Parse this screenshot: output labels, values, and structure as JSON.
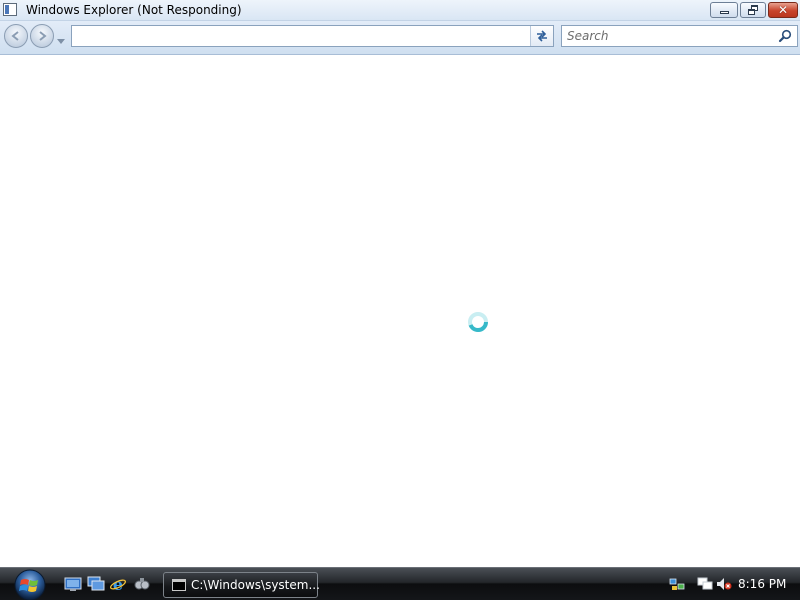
{
  "window": {
    "title": "Windows Explorer (Not Responding)",
    "caption_buttons": {
      "minimize": "minimize",
      "restore": "restore",
      "close": "✕"
    }
  },
  "nav": {
    "address_value": "",
    "search_placeholder": "Search"
  },
  "content": {
    "state": "busy",
    "cursor": "busy-cursor-icon"
  },
  "taskbar": {
    "start_icon": "windows-logo-icon",
    "quick_launch": [
      "show-desktop-icon",
      "switch-windows-icon",
      "ie-icon",
      "media-player-icon"
    ],
    "task_button": {
      "label": "C:\\Windows\\system...",
      "icon": "cmd-icon"
    },
    "tray_icons": [
      "network-tray-icon",
      "connection-icon",
      "volume-muted-icon"
    ],
    "clock": "8:16 PM"
  },
  "colors": {
    "titlebar": "#dce8f5",
    "close_button": "#c8442c",
    "taskbar": "#1a1c1f",
    "busy_cursor": "#36b9c9"
  }
}
